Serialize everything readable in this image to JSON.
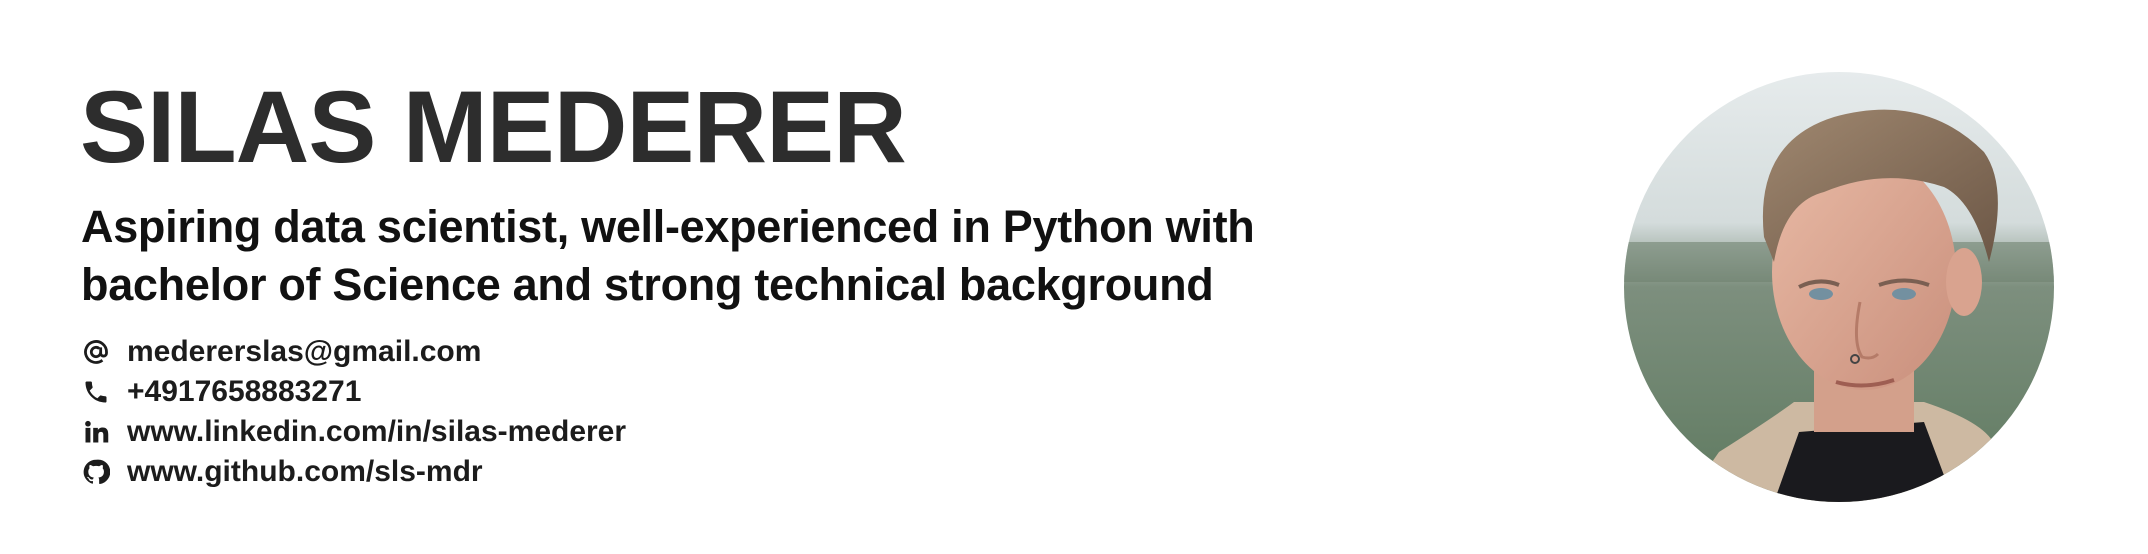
{
  "profile": {
    "name": "SILAS MEDERER",
    "tagline_line1": "Aspiring data scientist, well-experienced in Python with",
    "tagline_line2": "bachelor of Science and strong technical background"
  },
  "contacts": [
    {
      "icon": "at-icon",
      "text": "medererslas@gmail.com"
    },
    {
      "icon": "phone-icon",
      "text": "+4917658883271"
    },
    {
      "icon": "linkedin-icon",
      "text": "www.linkedin.com/in/silas-mederer"
    },
    {
      "icon": "github-icon",
      "text": "www.github.com/sls-mdr"
    }
  ],
  "colors": {
    "name": "#2d2d2d",
    "tagline": "#111111",
    "contact": "#1c1c1c",
    "background": "#ffffff"
  }
}
